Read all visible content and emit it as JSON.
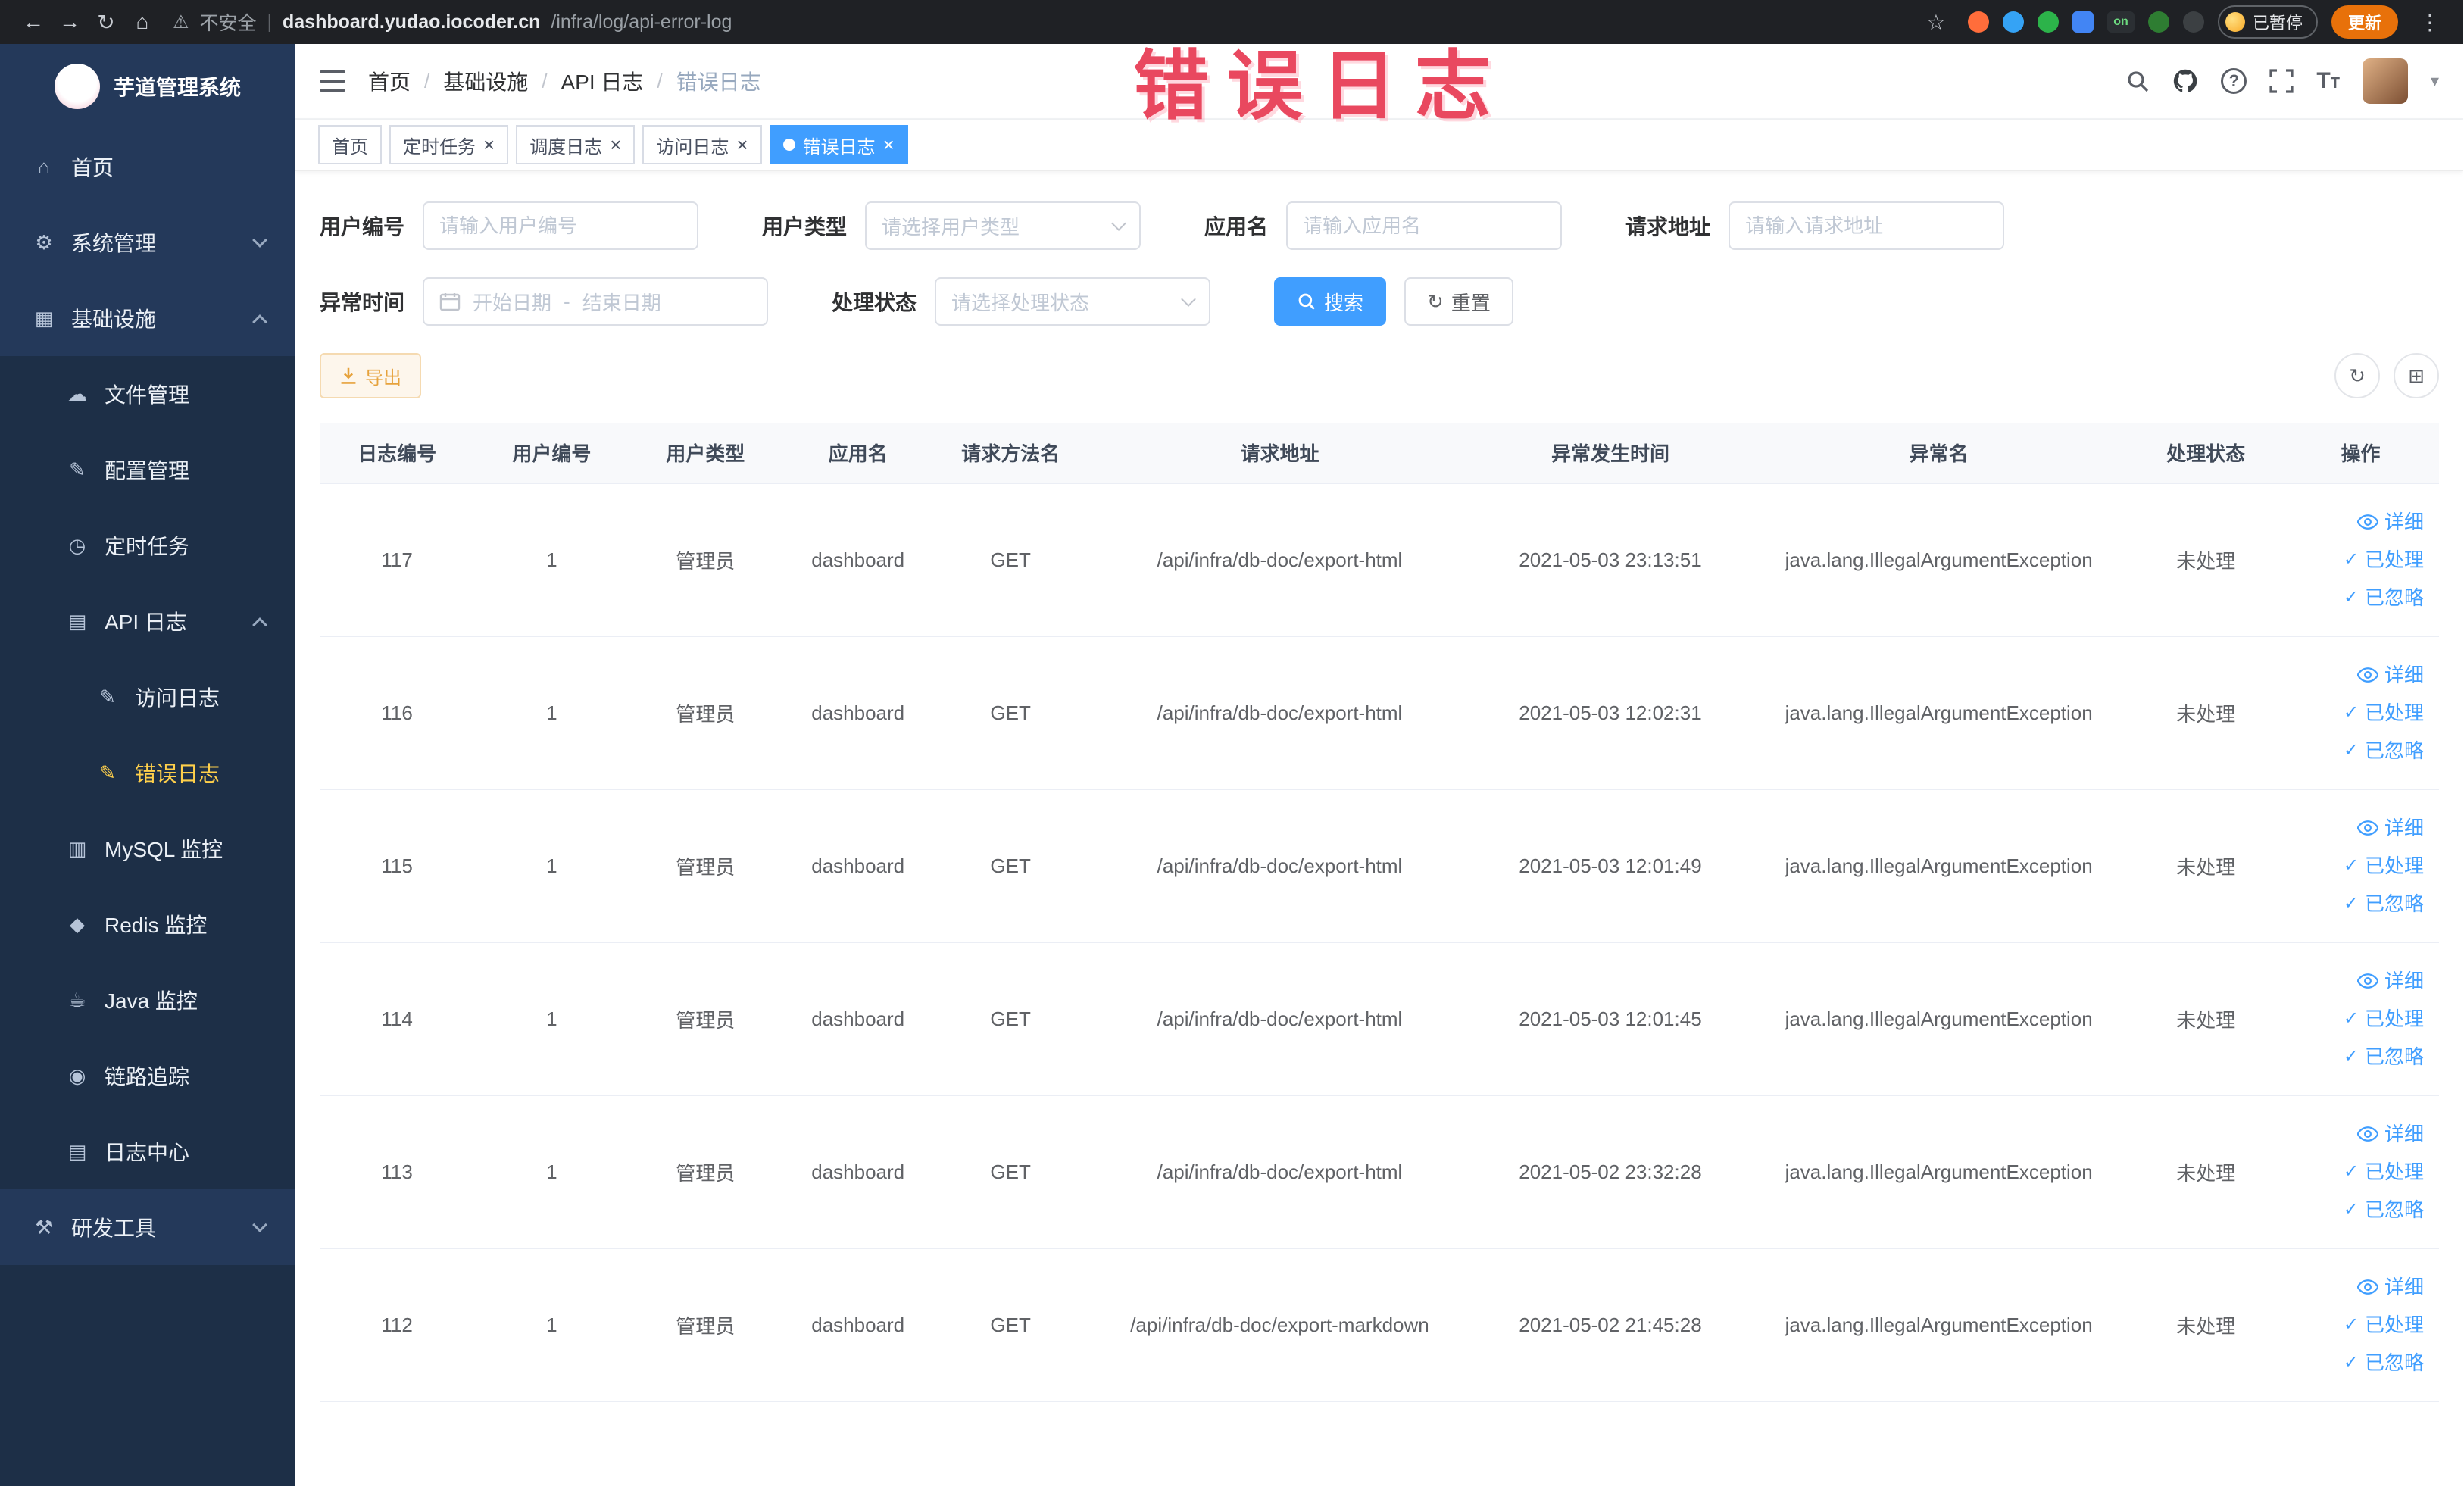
{
  "browser": {
    "warning_text": "不安全",
    "address_divider": "|",
    "url_host": "dashboard.yudao.iocoder.cn",
    "url_path": "/infra/log/api-error-log",
    "extension_on_label": "on",
    "paused_label": "已暂停",
    "update_label": "更新"
  },
  "annotation": {
    "text": "错误日志",
    "color": "#e9485f"
  },
  "icons": {
    "back": "←",
    "forward": "→",
    "reload": "↻",
    "browser_home": "⌂",
    "warning": "⚠",
    "star": "☆",
    "menu_dots": "⋮",
    "help": "?",
    "caret_down": "▾",
    "reset": "↻",
    "refresh": "↻",
    "columns": "⊞",
    "close": "×",
    "check": "✓",
    "font_large": "T",
    "font_small": "T"
  },
  "sidebar": {
    "logo_title": "芋道管理系统",
    "icon_glyphs": {
      "home-icon": "⌂",
      "gear-icon": "⚙",
      "infrastructure-icon": "▦",
      "cloud-icon": "☁",
      "edit-icon": "✎",
      "clock-icon": "◷",
      "document-icon": "▤",
      "edit-square-icon": "✎",
      "mysql-icon": "▥",
      "redis-icon": "◆",
      "java-icon": "☕",
      "eye-icon": "◉",
      "log-center-icon": "▤",
      "tools-icon": "⚒"
    },
    "items": [
      {
        "key": "home",
        "label": "首页",
        "icon": "home-icon",
        "level": 0
      },
      {
        "key": "system-management",
        "label": "系统管理",
        "icon": "gear-icon",
        "level": 0,
        "chevron": "down"
      },
      {
        "key": "infrastructure",
        "label": "基础设施",
        "icon": "infrastructure-icon",
        "level": 0,
        "chevron": "up"
      },
      {
        "key": "file-management",
        "label": "文件管理",
        "icon": "cloud-icon",
        "level": 1
      },
      {
        "key": "config-management",
        "label": "配置管理",
        "icon": "edit-icon",
        "level": 1
      },
      {
        "key": "scheduled-jobs",
        "label": "定时任务",
        "icon": "clock-icon",
        "level": 1
      },
      {
        "key": "api-log",
        "label": "API 日志",
        "icon": "document-icon",
        "level": 1,
        "chevron": "up"
      },
      {
        "key": "access-log",
        "label": "访问日志",
        "icon": "edit-square-icon",
        "level": 2
      },
      {
        "key": "error-log",
        "label": "错误日志",
        "icon": "edit-square-icon",
        "level": 2,
        "active": true
      },
      {
        "key": "mysql-monitor",
        "label": "MySQL 监控",
        "icon": "mysql-icon",
        "level": 1
      },
      {
        "key": "redis-monitor",
        "label": "Redis 监控",
        "icon": "redis-icon",
        "level": 1
      },
      {
        "key": "java-monitor",
        "label": "Java 监控",
        "icon": "java-icon",
        "level": 1
      },
      {
        "key": "trace",
        "label": "链路追踪",
        "icon": "eye-icon",
        "level": 1
      },
      {
        "key": "log-center",
        "label": "日志中心",
        "icon": "log-center-icon",
        "level": 1
      },
      {
        "key": "dev-tools",
        "label": "研发工具",
        "icon": "tools-icon",
        "level": 0,
        "chevron": "down"
      }
    ]
  },
  "header": {
    "breadcrumb_separator": "/",
    "breadcrumb": [
      {
        "key": "home",
        "label": "首页"
      },
      {
        "key": "infrastructure",
        "label": "基础设施"
      },
      {
        "key": "api-log",
        "label": "API 日志"
      },
      {
        "key": "error-log",
        "label": "错误日志",
        "current": true
      }
    ]
  },
  "tabs": [
    {
      "key": "home",
      "label": "首页",
      "closable": false,
      "active": false
    },
    {
      "key": "scheduled-jobs",
      "label": "定时任务",
      "closable": true,
      "active": false
    },
    {
      "key": "schedule-log",
      "label": "调度日志",
      "closable": true,
      "active": false
    },
    {
      "key": "access-log",
      "label": "访问日志",
      "closable": true,
      "active": false
    },
    {
      "key": "error-log",
      "label": "错误日志",
      "closable": true,
      "active": true
    }
  ],
  "filters": {
    "user_id_label": "用户编号",
    "user_id_placeholder": "请输入用户编号",
    "user_type_label": "用户类型",
    "user_type_placeholder": "请选择用户类型",
    "app_name_label": "应用名",
    "app_name_placeholder": "请输入应用名",
    "request_url_label": "请求地址",
    "request_url_placeholder": "请输入请求地址",
    "exception_time_label": "异常时间",
    "date_start_placeholder": "开始日期",
    "date_separator": "-",
    "date_end_placeholder": "结束日期",
    "process_status_label": "处理状态",
    "process_status_placeholder": "请选择处理状态",
    "search_label": "搜索",
    "reset_label": "重置"
  },
  "toolbar": {
    "export_label": "导出"
  },
  "table": {
    "columns": [
      "日志编号",
      "用户编号",
      "用户类型",
      "应用名",
      "请求方法名",
      "请求地址",
      "异常发生时间",
      "异常名",
      "处理状态",
      "操作"
    ],
    "action_labels": {
      "detail": "详细",
      "processed": "已处理",
      "ignored": "已忽略"
    },
    "rows": [
      {
        "log_id": "117",
        "user_id": "1",
        "user_type": "管理员",
        "app_name": "dashboard",
        "method": "GET",
        "request_url": "/api/infra/db-doc/export-html",
        "time": "2021-05-03 23:13:51",
        "exception": "java.lang.IllegalArgumentException",
        "status": "未处理"
      },
      {
        "log_id": "116",
        "user_id": "1",
        "user_type": "管理员",
        "app_name": "dashboard",
        "method": "GET",
        "request_url": "/api/infra/db-doc/export-html",
        "time": "2021-05-03 12:02:31",
        "exception": "java.lang.IllegalArgumentException",
        "status": "未处理"
      },
      {
        "log_id": "115",
        "user_id": "1",
        "user_type": "管理员",
        "app_name": "dashboard",
        "method": "GET",
        "request_url": "/api/infra/db-doc/export-html",
        "time": "2021-05-03 12:01:49",
        "exception": "java.lang.IllegalArgumentException",
        "status": "未处理"
      },
      {
        "log_id": "114",
        "user_id": "1",
        "user_type": "管理员",
        "app_name": "dashboard",
        "method": "GET",
        "request_url": "/api/infra/db-doc/export-html",
        "time": "2021-05-03 12:01:45",
        "exception": "java.lang.IllegalArgumentException",
        "status": "未处理"
      },
      {
        "log_id": "113",
        "user_id": "1",
        "user_type": "管理员",
        "app_name": "dashboard",
        "method": "GET",
        "request_url": "/api/infra/db-doc/export-html",
        "time": "2021-05-02 23:32:28",
        "exception": "java.lang.IllegalArgumentException",
        "status": "未处理"
      },
      {
        "log_id": "112",
        "user_id": "1",
        "user_type": "管理员",
        "app_name": "dashboard",
        "method": "GET",
        "request_url": "/api/infra/db-doc/export-markdown",
        "time": "2021-05-02 21:45:28",
        "exception": "java.lang.IllegalArgumentException",
        "status": "未处理"
      }
    ]
  },
  "colors": {
    "accent_blue": "#409eff",
    "sidebar_active_text": "#ffd04b",
    "export_orange": "#e6a23c",
    "annotation_pink": "#e9485f"
  }
}
